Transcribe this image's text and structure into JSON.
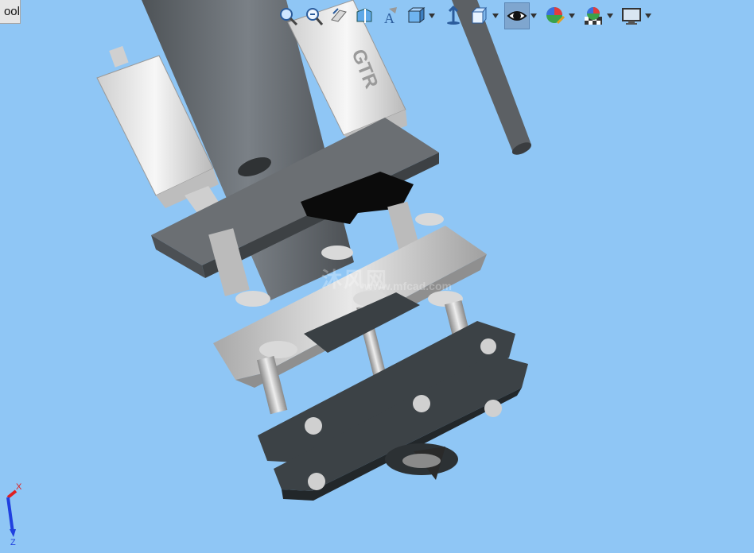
{
  "window": {
    "tab_stub_label": "ool"
  },
  "toolbar": {
    "buttons": [
      {
        "icon": "zoom-to-fit-icon",
        "has_dropdown": false
      },
      {
        "icon": "zoom-area-icon",
        "has_dropdown": false
      },
      {
        "icon": "previous-view-icon",
        "has_dropdown": false
      },
      {
        "icon": "section-view-icon",
        "has_dropdown": false
      },
      {
        "icon": "dynamic-annotation-icon",
        "has_dropdown": false
      },
      {
        "icon": "view-orientation-icon",
        "has_dropdown": true
      },
      {
        "icon": "display-style-icon",
        "has_dropdown": true
      },
      {
        "icon": "hide-show-items-icon",
        "has_dropdown": true,
        "active": true
      },
      {
        "icon": "edit-appearance-icon",
        "has_dropdown": true
      },
      {
        "icon": "apply-scene-icon",
        "has_dropdown": true
      },
      {
        "icon": "view-settings-icon",
        "has_dropdown": true
      }
    ]
  },
  "model": {
    "name_plate_text": "GTR",
    "watermark": "沐风网",
    "watermark_sub": "www.mfcad.com"
  },
  "triad": {
    "x_label": "X",
    "z_label": "Z"
  },
  "colors": {
    "viewport_bg": "#8fc6f5",
    "metal_dark": "#5e6266",
    "metal_light": "#c9c9c9",
    "gasket": "#3c4246",
    "handle": "#0a0a0a",
    "axis_x": "#e02020",
    "axis_z": "#2040e0"
  }
}
